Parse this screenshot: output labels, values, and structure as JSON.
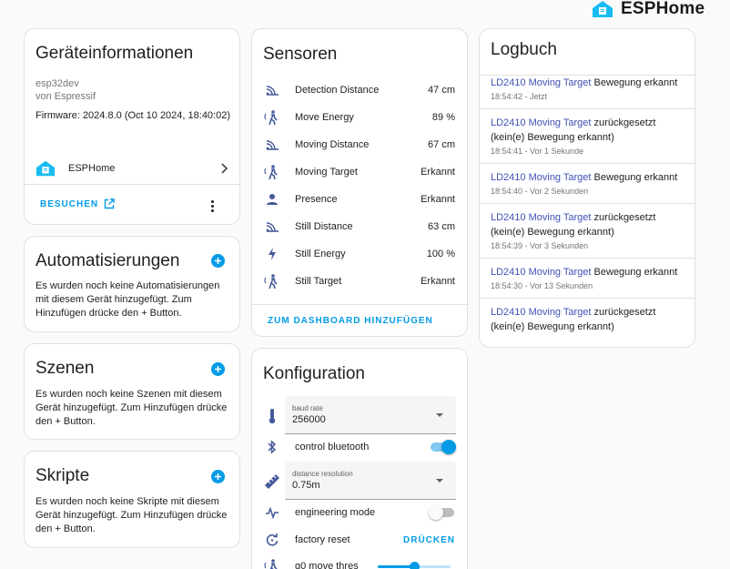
{
  "brand": {
    "name": "ESPHome",
    "icon": "esphome-logo-icon"
  },
  "device": {
    "title": "Geräteinformationen",
    "model": "esp32dev",
    "manufacturer": "von Espressif",
    "firmware": "Firmware: 2024.8.0 (Oct 10 2024, 18:40:02)",
    "integration": "ESPHome",
    "visit_label": "BESUCHEN"
  },
  "automations": {
    "title": "Automatisierungen",
    "desc": "Es wurden noch keine Automatisierungen mit diesem Gerät hinzugefügt. Zum Hinzufügen drücke den + Button."
  },
  "scenes": {
    "title": "Szenen",
    "desc": "Es wurden noch keine Szenen mit diesem Gerät hinzugefügt. Zum Hinzufügen drücke den + Button."
  },
  "scripts": {
    "title": "Skripte",
    "desc": "Es wurden noch keine Skripte mit diesem Gerät hinzugefügt. Zum Hinzufügen drücke den + Button."
  },
  "sensors": {
    "title": "Sensoren",
    "items": [
      {
        "name": "Detection Distance",
        "value": "47 cm",
        "icon": "signal-distance-icon"
      },
      {
        "name": "Move Energy",
        "value": "89 %",
        "icon": "motion-sensor-icon"
      },
      {
        "name": "Moving Distance",
        "value": "67 cm",
        "icon": "signal-distance-icon"
      },
      {
        "name": "Moving Target",
        "value": "Erkannt",
        "icon": "motion-sensor-icon"
      },
      {
        "name": "Presence",
        "value": "Erkannt",
        "icon": "account-icon"
      },
      {
        "name": "Still Distance",
        "value": "63 cm",
        "icon": "signal-distance-icon"
      },
      {
        "name": "Still Energy",
        "value": "100 %",
        "icon": "flash-icon"
      },
      {
        "name": "Still Target",
        "value": "Erkannt",
        "icon": "motion-sensor-icon"
      }
    ],
    "add_label": "ZUM DASHBOARD HINZUFÜGEN"
  },
  "config": {
    "title": "Konfiguration",
    "baud": {
      "label": "baud rate",
      "value": "256000",
      "icon": "thermometer-icon"
    },
    "bluetooth": {
      "label": "control bluetooth",
      "on": true,
      "icon": "bluetooth-icon"
    },
    "resolution": {
      "label": "distance resolution",
      "value": "0.75m",
      "icon": "ruler-icon"
    },
    "engineering": {
      "label": "engineering mode",
      "on": false,
      "icon": "pulse-icon"
    },
    "factory": {
      "label": "factory reset",
      "button": "DRÜCKEN",
      "icon": "restart-icon"
    },
    "g0": {
      "label": "g0 move thres",
      "level": 0.5,
      "icon": "motion-sensor-icon"
    }
  },
  "logbook": {
    "title": "Logbuch",
    "entries": [
      {
        "entity": "LD2410 Moving Target",
        "text": " Bewegung erkannt",
        "time": "18:54:42 - Jetzt"
      },
      {
        "entity": "LD2410 Moving Target",
        "text": " zurückgesetzt (kein(e) Bewegung erkannt)",
        "time": "18:54:41 - Vor 1 Sekunde"
      },
      {
        "entity": "LD2410 Moving Target",
        "text": " Bewegung erkannt",
        "time": "18:54:40 - Vor 2 Sekunden"
      },
      {
        "entity": "LD2410 Moving Target",
        "text": " zurückgesetzt (kein(e) Bewegung erkannt)",
        "time": "18:54:39 - Vor 3 Sekunden"
      },
      {
        "entity": "LD2410 Moving Target",
        "text": " Bewegung erkannt",
        "time": "18:54:30 - Vor 13 Sekunden"
      },
      {
        "entity": "LD2410 Moving Target",
        "text": " zurückgesetzt (kein(e) Bewegung erkannt)",
        "time": ""
      }
    ]
  },
  "colors": {
    "accent": "#039be5",
    "icon": "#455a9a",
    "link": "#3f51b5"
  }
}
